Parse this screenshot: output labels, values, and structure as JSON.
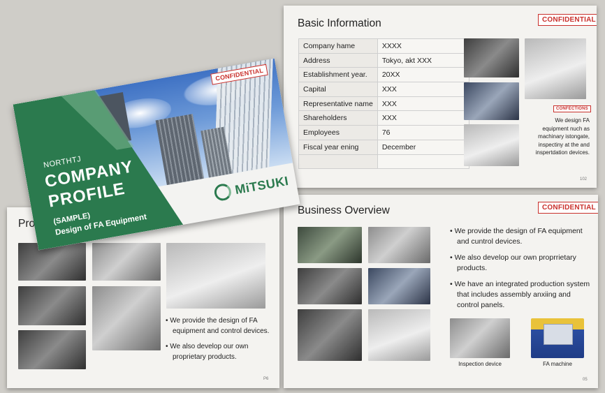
{
  "basic": {
    "title": "Basic Information",
    "confidential": "CONFIDENTIAL",
    "rows": [
      {
        "k": "Company hame",
        "v": "XXXX"
      },
      {
        "k": "Address",
        "v": "Tokyo, akt XXX"
      },
      {
        "k": "Establishment year.",
        "v": "20XX"
      },
      {
        "k": "Capital",
        "v": "XXX"
      },
      {
        "k": "Representative name",
        "v": "XXX"
      },
      {
        "k": "Shareholders",
        "v": "XXX"
      },
      {
        "k": "Employees",
        "v": "76"
      },
      {
        "k": "Fiscal year ening",
        "v": "December"
      },
      {
        "k": "",
        "v": ""
      }
    ],
    "small_badge": "CONFECTIONS",
    "caption": "We design FA equipment  nuch as machinary istongate, inspectiny at the and inspertdation devices.",
    "page": "102"
  },
  "business": {
    "title": "Business Overview",
    "confidential": "CONFIDENTIAL",
    "bullets": [
      "• We provide the design of FA equipment and cuntrol devices.",
      "• We also develop our own proprrietary products.",
      "• We have an integrated production system that includes assembly anxiing and control panels."
    ],
    "thumb1_label": "Inspection device",
    "thumb2_label": "FA machine",
    "page": "05"
  },
  "products": {
    "title": "Pro",
    "bullets": [
      "• We provide the design of FA equipment and control devices.",
      "• We also develop our own proprietary products."
    ],
    "page": "P6"
  },
  "cover": {
    "company_small": "NORTHTJ",
    "title_line1": "COMPANY",
    "title_line2": "PROFILE",
    "subtitle1": "(SAMPLE)",
    "subtitle2": "Design of FA Equipment",
    "confidential": "CONFIDENTIAL",
    "logo_text": "MiTSUKI"
  },
  "colors": {
    "accent_green": "#2d7a4f",
    "confidential_red": "#c9302c"
  }
}
